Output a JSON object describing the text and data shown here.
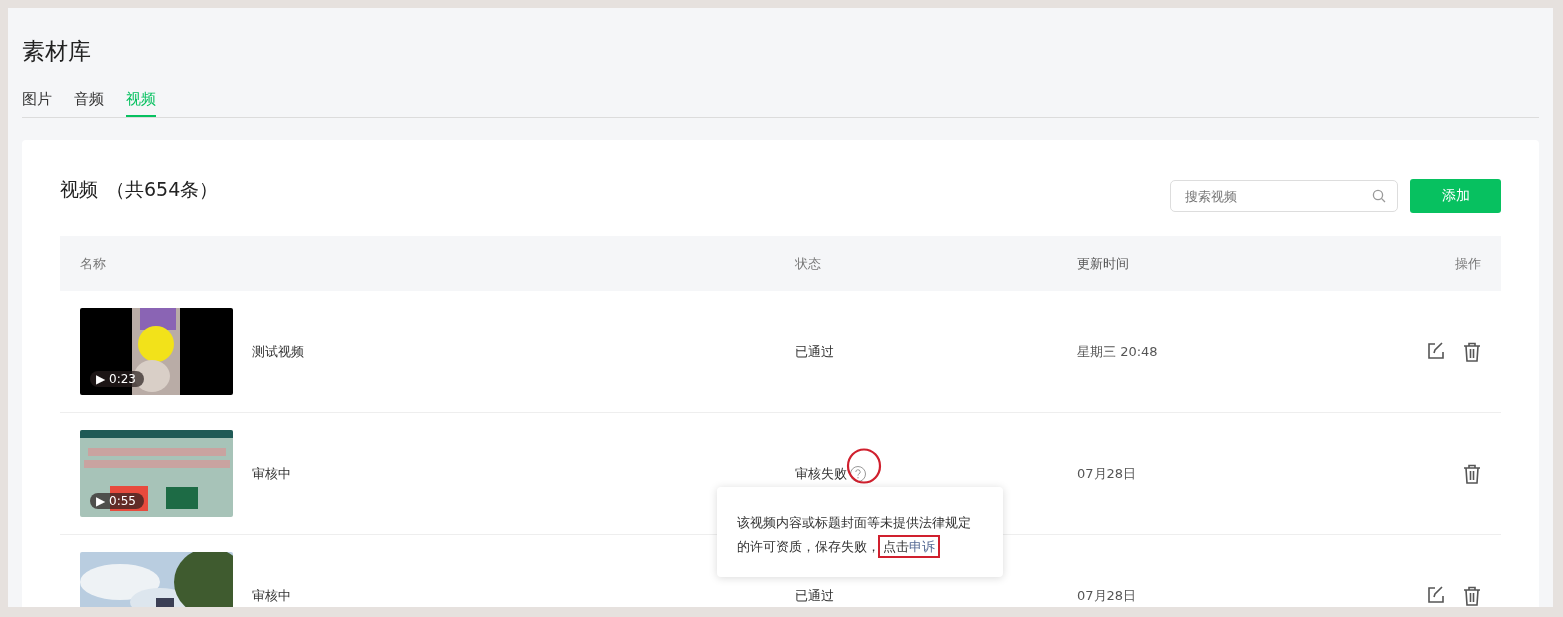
{
  "page_title": "素材库",
  "tabs": [
    {
      "label": "图片",
      "selected": false
    },
    {
      "label": "音频",
      "selected": false
    },
    {
      "label": "视频",
      "selected": true
    }
  ],
  "section": {
    "title": "视频",
    "count": "（共654条）"
  },
  "search": {
    "placeholder": "搜索视频"
  },
  "add_button": "添加",
  "columns": [
    "名称",
    "状态",
    "更新时间",
    "操作"
  ],
  "rows": [
    {
      "thumbnail": {
        "kind": "picture",
        "duration": "▶ 0:23"
      },
      "name": "测试视频",
      "status": "已通过",
      "status_help": false,
      "updated": "星期三 20:48",
      "editable": true
    },
    {
      "thumbnail": {
        "kind": "picture",
        "duration": "▶ 0:55"
      },
      "name": "审核中",
      "status": "审核失败",
      "status_help": true,
      "updated": "07月28日",
      "editable": false
    },
    {
      "name": "审核中",
      "status": "已通过",
      "status_help": false,
      "updated": "07月28日",
      "editable": true
    }
  ],
  "tooltip": {
    "text": "该视频内容或标题封面等未提供法律规定的许可资质，保存失败，",
    "link_prefix": "点击",
    "link": "申诉"
  }
}
